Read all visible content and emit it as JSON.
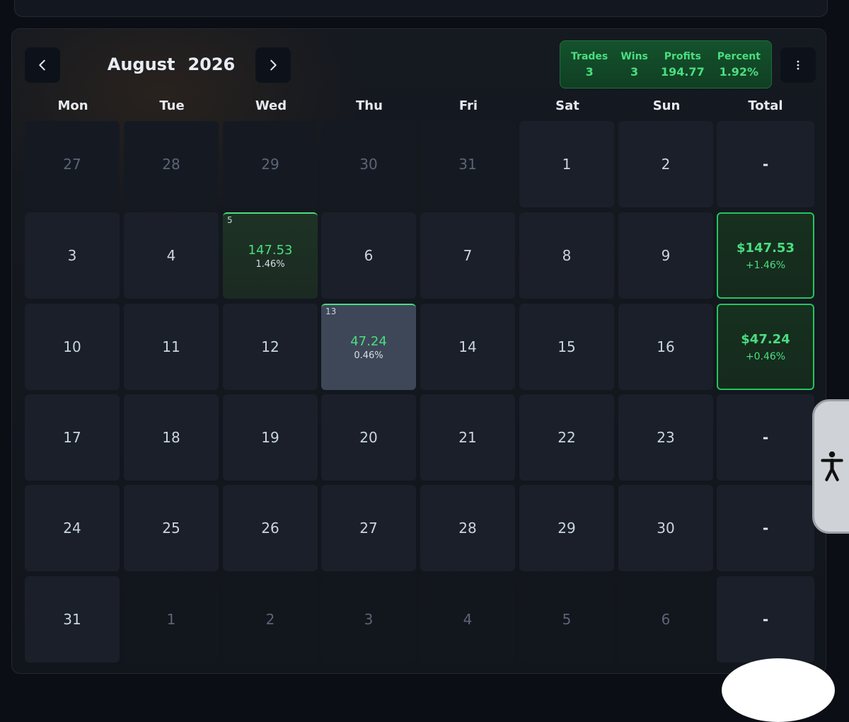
{
  "calendar": {
    "month": "August",
    "year": "2026",
    "weekdays": [
      "Mon",
      "Tue",
      "Wed",
      "Thu",
      "Fri",
      "Sat",
      "Sun"
    ],
    "total_label": "Total",
    "weeks": [
      {
        "days": [
          {
            "day": "27",
            "current": false
          },
          {
            "day": "28",
            "current": false
          },
          {
            "day": "29",
            "current": false
          },
          {
            "day": "30",
            "current": false
          },
          {
            "day": "31",
            "current": false
          },
          {
            "day": "1",
            "current": true
          },
          {
            "day": "2",
            "current": true
          }
        ],
        "total": "-"
      },
      {
        "days": [
          {
            "day": "3",
            "current": true
          },
          {
            "day": "4",
            "current": true
          },
          {
            "day": "5",
            "current": true,
            "trade": {
              "profit": "147.53",
              "percent": "1.46%",
              "style": "green"
            }
          },
          {
            "day": "6",
            "current": true
          },
          {
            "day": "7",
            "current": true
          },
          {
            "day": "8",
            "current": true
          },
          {
            "day": "9",
            "current": true
          }
        ],
        "total": {
          "amount": "$147.53",
          "percent": "+1.46%"
        }
      },
      {
        "days": [
          {
            "day": "10",
            "current": true
          },
          {
            "day": "11",
            "current": true
          },
          {
            "day": "12",
            "current": true
          },
          {
            "day": "13",
            "current": true,
            "trade": {
              "profit": "47.24",
              "percent": "0.46%",
              "style": "selected"
            }
          },
          {
            "day": "14",
            "current": true
          },
          {
            "day": "15",
            "current": true
          },
          {
            "day": "16",
            "current": true
          }
        ],
        "total": {
          "amount": "$47.24",
          "percent": "+0.46%"
        }
      },
      {
        "days": [
          {
            "day": "17",
            "current": true
          },
          {
            "day": "18",
            "current": true
          },
          {
            "day": "19",
            "current": true
          },
          {
            "day": "20",
            "current": true
          },
          {
            "day": "21",
            "current": true
          },
          {
            "day": "22",
            "current": true
          },
          {
            "day": "23",
            "current": true
          }
        ],
        "total": "-"
      },
      {
        "days": [
          {
            "day": "24",
            "current": true
          },
          {
            "day": "25",
            "current": true
          },
          {
            "day": "26",
            "current": true
          },
          {
            "day": "27",
            "current": true
          },
          {
            "day": "28",
            "current": true
          },
          {
            "day": "29",
            "current": true
          },
          {
            "day": "30",
            "current": true
          }
        ],
        "total": "-"
      },
      {
        "days": [
          {
            "day": "31",
            "current": true
          },
          {
            "day": "1",
            "current": false
          },
          {
            "day": "2",
            "current": false
          },
          {
            "day": "3",
            "current": false
          },
          {
            "day": "4",
            "current": false
          },
          {
            "day": "5",
            "current": false
          },
          {
            "day": "6",
            "current": false
          }
        ],
        "total": "-"
      }
    ]
  },
  "stats": {
    "trades_label": "Trades",
    "trades_value": "3",
    "wins_label": "Wins",
    "wins_value": "3",
    "profits_label": "Profits",
    "profits_value": "194.77",
    "percent_label": "Percent",
    "percent_value": "1.92%"
  },
  "icons": {
    "prev": "chevron-left-icon",
    "next": "chevron-right-icon",
    "menu": "more-vertical-icon",
    "accessibility": "accessibility-person-icon"
  },
  "colors": {
    "profit_green": "#4ade80",
    "panel_bg": "#1a1f29",
    "selected_cell": "#3e4758"
  }
}
